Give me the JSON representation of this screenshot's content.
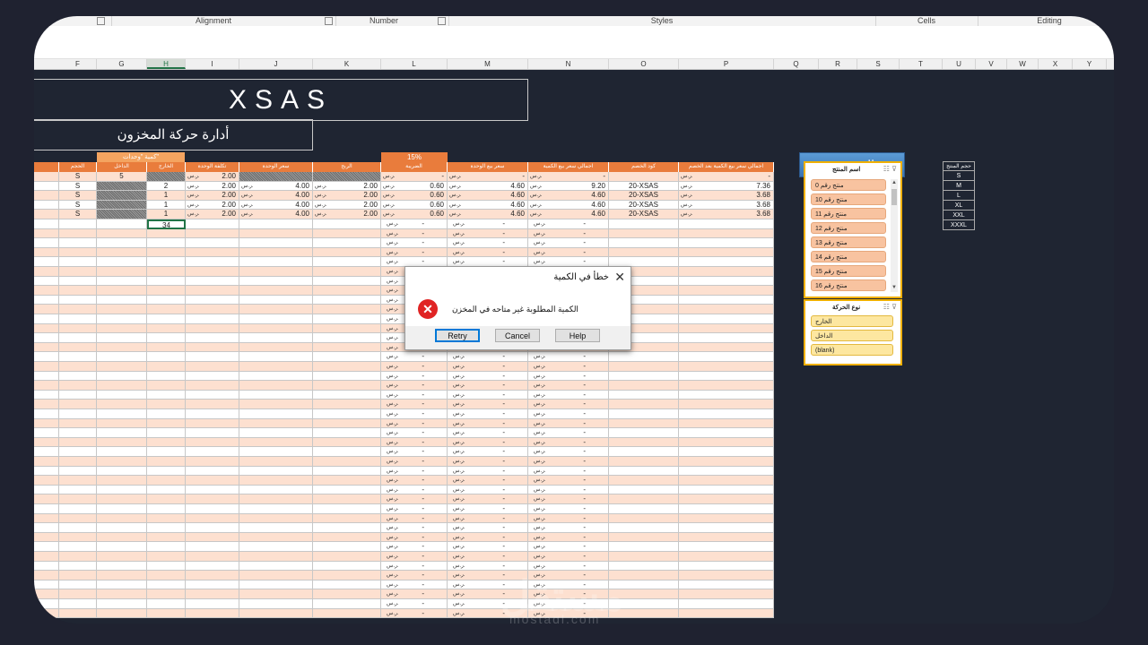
{
  "ribbon": {
    "groups": [
      "Alignment",
      "Number",
      "Styles",
      "Cells",
      "Editing"
    ]
  },
  "columns": [
    "F",
    "G",
    "H",
    "I",
    "J",
    "K",
    "L",
    "M",
    "N",
    "O",
    "P",
    "Q",
    "R",
    "S",
    "T",
    "U",
    "V",
    "W",
    "X",
    "Y"
  ],
  "selected_column": "H",
  "title": "XSAS",
  "subtitle": "أدارة حركة المخزون",
  "header_band": {
    "qty_label": "كمية \"وحدات\"",
    "tax_rate": "15%"
  },
  "table_headers": [
    "الحجم",
    "الداخل",
    "الخارج",
    "تكلفة  الوحدة",
    "سعر الوحدة",
    "الربح",
    "الضريبة",
    "سعر بيع الوحدة",
    "اجمالي سعر بيع الكمية",
    "كود الخصم",
    "اجمالي سعر بيع الكمية بعد الخصم"
  ],
  "currency": "ر.س.",
  "data_rows": [
    {
      "size": "S",
      "in": "5",
      "out": "",
      "cost": "2.00",
      "unit_price": "",
      "profit": "",
      "tax": "-",
      "sell_unit": "-",
      "sell_total": "-",
      "code": "",
      "after": "-"
    },
    {
      "size": "S",
      "in": "",
      "out": "2",
      "cost": "2.00",
      "unit_price": "4.00",
      "profit": "2.00",
      "tax": "0.60",
      "sell_unit": "4.60",
      "sell_total": "9.20",
      "code": "20-XSAS",
      "after": "7.36"
    },
    {
      "size": "S",
      "in": "",
      "out": "1",
      "cost": "2.00",
      "unit_price": "4.00",
      "profit": "2.00",
      "tax": "0.60",
      "sell_unit": "4.60",
      "sell_total": "4.60",
      "code": "20-XSAS",
      "after": "3.68"
    },
    {
      "size": "S",
      "in": "",
      "out": "1",
      "cost": "2.00",
      "unit_price": "4.00",
      "profit": "2.00",
      "tax": "0.60",
      "sell_unit": "4.60",
      "sell_total": "4.60",
      "code": "20-XSAS",
      "after": "3.68"
    },
    {
      "size": "S",
      "in": "",
      "out": "1",
      "cost": "2.00",
      "unit_price": "4.00",
      "profit": "2.00",
      "tax": "0.60",
      "sell_unit": "4.60",
      "sell_total": "4.60",
      "code": "20-XSAS",
      "after": "3.68"
    }
  ],
  "active_cell_value": "34",
  "empty_row_count": 42,
  "empty_dash": "-",
  "dialog": {
    "title": "خطأ في الكمية",
    "message": "الكمية المطلوبة غير متاحه في المخزن",
    "close": "✕",
    "buttons": [
      "Retry",
      "Cancel",
      "Help"
    ]
  },
  "inventory_title": "المخزون",
  "product_slicer": {
    "header": "اسم المنتج",
    "items": [
      "منتج رقم 0",
      "منتج رقم 10",
      "منتج رقم 11",
      "منتج رقم 12",
      "منتج رقم 13",
      "منتج رقم 14",
      "منتج رقم 15",
      "منتج رقم 16"
    ]
  },
  "movement_slicer": {
    "header": "نوع الحركة",
    "items": [
      "الخارج",
      "الداخل",
      "(blank)"
    ]
  },
  "sizes": {
    "header": "حجم المنتج",
    "items": [
      "S",
      "M",
      "L",
      "XL",
      "XXL",
      "XXXL"
    ]
  },
  "watermark": {
    "brand": "مستقل",
    "site": "mostaql.com"
  },
  "colors": {
    "background": "#1f2532",
    "orange": "#e97c3c",
    "row_alt": "#fde0d0",
    "accent_blue": "#3b74b3"
  }
}
